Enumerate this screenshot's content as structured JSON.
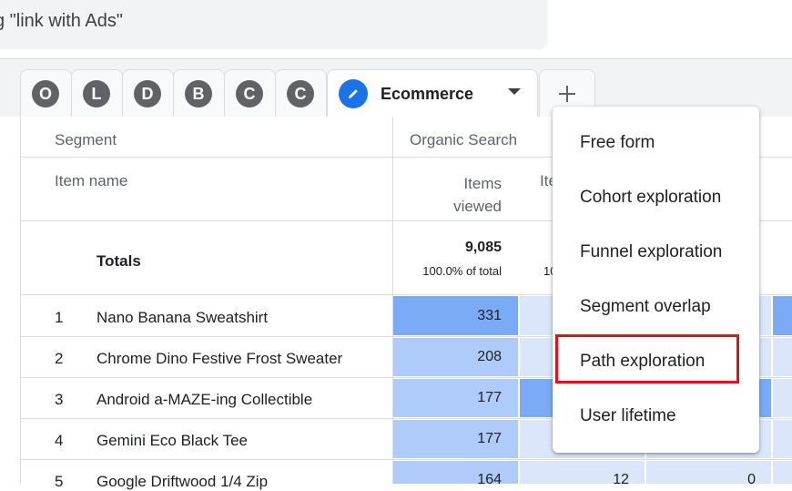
{
  "search": {
    "text": "g \"link with Ads\""
  },
  "segment_tabs": [
    "O",
    "L",
    "D",
    "B",
    "C",
    "C"
  ],
  "active_tab": {
    "label": "Ecommerce",
    "icon": "pencil-icon"
  },
  "add_tab_icon": "plus-icon",
  "table": {
    "row_dim_header": "Segment",
    "segment_value": "Organic Search",
    "item_name_header": "Item name",
    "metric_header": "Items viewed",
    "metric_header_line1": "Items",
    "metric_header_line2": "viewed",
    "metric2_header_partial": "Ite",
    "totals_label": "Totals",
    "totals_value": "9,085",
    "totals_pct": "100.0% of total",
    "totals2_pct_partial": "10",
    "rows": [
      {
        "index": "1",
        "name": "Nano Banana Sweatshirt",
        "viewed": "331",
        "c3": "",
        "c4": ""
      },
      {
        "index": "2",
        "name": "Chrome Dino Festive Frost Sweater",
        "viewed": "208",
        "c3": "",
        "c4": ""
      },
      {
        "index": "3",
        "name": "Android a-MAZE-ing Collectible",
        "viewed": "177",
        "c3": "",
        "c4": ""
      },
      {
        "index": "4",
        "name": "Gemini Eco Black Tee",
        "viewed": "177",
        "c3": "",
        "c4": ""
      },
      {
        "index": "5",
        "name": "Google Driftwood 1/4 Zip",
        "viewed": "164",
        "c3": "12",
        "c4": "0"
      }
    ]
  },
  "menu": {
    "items": [
      "Free form",
      "Cohort exploration",
      "Funnel exploration",
      "Segment overlap",
      "Path exploration",
      "User lifetime"
    ],
    "highlighted": "Path exploration",
    "highlight_color": "#e0101e"
  },
  "colors": {
    "accent": "#1a73e8",
    "heat_dark": "#7baaf7",
    "heat_mid": "#aecbfa",
    "heat_light": "#dbe6fb"
  }
}
